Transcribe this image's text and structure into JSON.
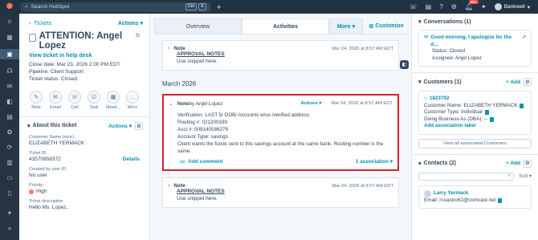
{
  "topbar": {
    "logo": "hubspot-sprocket",
    "search_placeholder": "Search HubSpot",
    "shortcut_keys": [
      "Ctrl",
      "K"
    ],
    "notif_badge": "99+",
    "account_name": "Bankwell"
  },
  "ticket": {
    "back_label": "Tickets",
    "actions_label": "Actions",
    "title": "ATTENTION: Angel Lopez",
    "help_desk_link": "View ticket in help desk",
    "close_date": "Close date: Mar 23, 2026 2:00 PM EDT",
    "pipeline": "Pipeline: Client Support",
    "status": "Ticket status: Closed",
    "quick_actions": [
      {
        "label": "Note",
        "icon": "note-icon",
        "glyph": "✎"
      },
      {
        "label": "Email",
        "icon": "email-icon",
        "glyph": "✉"
      },
      {
        "label": "Call",
        "icon": "phone-icon",
        "glyph": "☏"
      },
      {
        "label": "Task",
        "icon": "task-icon",
        "glyph": "☑"
      },
      {
        "label": "Meeti...",
        "icon": "calendar-icon",
        "glyph": "▦"
      },
      {
        "label": "More",
        "icon": "more-icon",
        "glyph": "…"
      }
    ],
    "about_label": "About this ticket",
    "about_actions": "Actions",
    "properties": [
      {
        "key": "Customer Name (sync)",
        "value": "ELIZABETH YERMACK"
      },
      {
        "key": "Ticket ID",
        "value": "43570958372",
        "link": "Details"
      },
      {
        "key": "Created by user ID",
        "value": "No user"
      },
      {
        "key": "Priority",
        "value": "High"
      },
      {
        "key": "Ticket description",
        "value": "Hello Ms. Lopez,"
      }
    ]
  },
  "center": {
    "tabs": [
      "Overview",
      "Activities",
      "More",
      "Customize"
    ],
    "active_tab": "Activities",
    "note1": {
      "type": "Note",
      "date": "Mar 24, 2026 at 8:57 AM EDT",
      "title": "APPROVAL NOTES",
      "text": "Use snippet here."
    },
    "month": "March 2026",
    "note2": {
      "type": "Note",
      "by": " by Anjel Lopez",
      "actions": "Actions",
      "date": "Mar 24, 2026 at 8:57 AM EDT",
      "lines": [
        "Verification: LAST 5/ DOB/ Accounts w/us /verified address",
        "Routing #: 021200339",
        "Acct #: 009140586279",
        "Account Type: savings",
        "Client wants the funds sent to this savings account at the same bank. Routing number is the same."
      ],
      "add_comment": "Add comment",
      "associations": "1 association"
    },
    "note3": {
      "type": "Note",
      "date": "Mar 24, 2026 at 8:57 AM EDT",
      "title": "APPROVAL NOTES",
      "text": "Use snippet here."
    }
  },
  "right": {
    "conversations": {
      "header": "Conversations (1)",
      "preview": "Good morning, I apologize for the d...",
      "status": "Status: Closed",
      "assignee": "Assignee: Anjel Lopez"
    },
    "customers": {
      "header": "Customers (1)",
      "add": "+ Add",
      "id": "1823792",
      "name": "Customer Name: ELIZABETH YERMACK",
      "type": "Customer Type: Individual",
      "dba": "Doing Business As (DBA): --",
      "add_label": "Add association label",
      "view_all": "View all associated Customers"
    },
    "contacts": {
      "header": "Contacts (2)",
      "add": "+ Add",
      "sort": "Sort",
      "name": "Larry Yermack",
      "email": "Email: rcoastro62@comcast.net"
    }
  }
}
